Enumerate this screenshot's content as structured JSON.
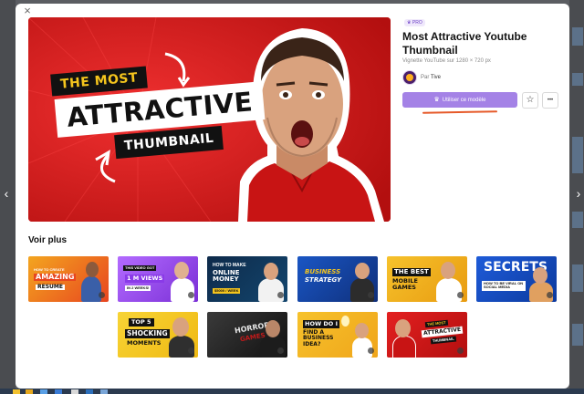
{
  "modal": {
    "close_glyph": "×",
    "prev_glyph": "‹",
    "next_glyph": "›"
  },
  "hero": {
    "line1": "THE MOST",
    "line2": "ATTRACTIVE",
    "line3": "THUMBNAIL"
  },
  "details": {
    "badge": "PRO",
    "title": "Most Attractive Youtube Thumbnail",
    "dimensions": "Vignette YouTube sur 1280 × 720 px",
    "author_prefix": "Par",
    "author_name": "Tive",
    "use_button": "Utiliser ce modèle",
    "star_glyph": "☆",
    "more_glyph": "•••"
  },
  "section": {
    "title": "Voir plus"
  },
  "thumbnails": [
    {
      "l1": "HOW TO CREATE",
      "l2": "AMAZING",
      "l3": "RESUME"
    },
    {
      "l1": "THIS VIDEO GOT",
      "l2": "1 M VIEWS",
      "l3": "IN 2 WEEKS!"
    },
    {
      "l1": "HOW TO MAKE",
      "l2": "ONLINE MONEY",
      "l3": "$5000 / WEEK"
    },
    {
      "l1": "BUSINESS",
      "l2": "STRATEGY",
      "l3": ""
    },
    {
      "l1": "THE BEST",
      "l2": "MOBILE GAMES",
      "l3": ""
    },
    {
      "l1": "SECRETS",
      "l2": "HOW TO BE VIRAL ON SOCIAL MEDIA",
      "l3": ""
    },
    {
      "l1": "TOP 5",
      "l2": "SHOCKING",
      "l3": "MOMENTS"
    },
    {
      "l1": "HORROR",
      "l2": "GAMES",
      "l3": ""
    },
    {
      "l1": "HOW DO I",
      "l2": "FIND A BUSINESS IDEA?",
      "l3": ""
    },
    {
      "l1": "THE MOST",
      "l2": "ATTRACTIVE",
      "l3": "THUMBNAIL"
    }
  ],
  "colors": {
    "accent": "#a482e6",
    "hero_red": "#d81818"
  }
}
